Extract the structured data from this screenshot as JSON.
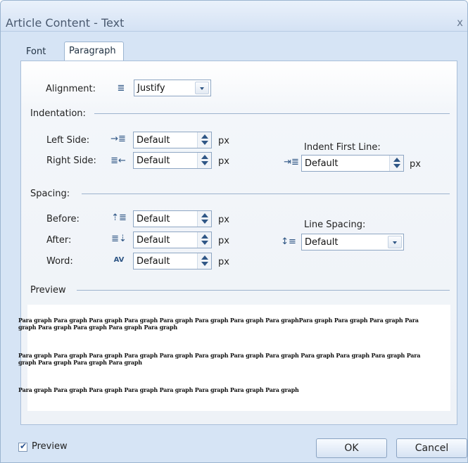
{
  "window": {
    "title": "Article Content - Text",
    "close_glyph": "x"
  },
  "tabs": [
    {
      "label": "Font"
    },
    {
      "label": "Paragraph"
    }
  ],
  "alignment": {
    "label": "Alignment:",
    "icon": "align-justify-icon",
    "value": "Justify"
  },
  "indentation": {
    "section": "Indentation:",
    "left_label": "Left Side:",
    "left_value": "Default",
    "right_label": "Right Side:",
    "right_value": "Default",
    "first_line_label": "Indent First Line:",
    "first_line_value": "Default",
    "unit": "px"
  },
  "spacing": {
    "section": "Spacing:",
    "before_label": "Before:",
    "before_value": "Default",
    "after_label": "After:",
    "after_value": "Default",
    "word_label": "Word:",
    "word_value": "Default",
    "line_label": "Line Spacing:",
    "line_value": "Default",
    "unit": "px"
  },
  "preview": {
    "section": "Preview",
    "paragraph_1": "Para graph Para graph Para graph Para graph Para graph Para graph Para graph Para graphPara graph Para graph Para graph Para graph Para graph Para graph Para graph Para graph",
    "paragraph_2": "Para graph Para graph Para graph Para graph Para graph Para graph Para graph Para graph Para graph Para graph Para graph Para graph Para graph Para graph Para graph",
    "paragraph_3": "Para graph Para graph Para graph Para graph Para graph Para graph Para graph Para graph"
  },
  "footer": {
    "preview_checkbox_label": "Preview",
    "preview_checked": true,
    "ok_label": "OK",
    "cancel_label": "Cancel"
  },
  "colors": {
    "dialog_bg": "#d6e4f5",
    "panel_border": "#a9bfd9",
    "accent": "#2f5685"
  }
}
